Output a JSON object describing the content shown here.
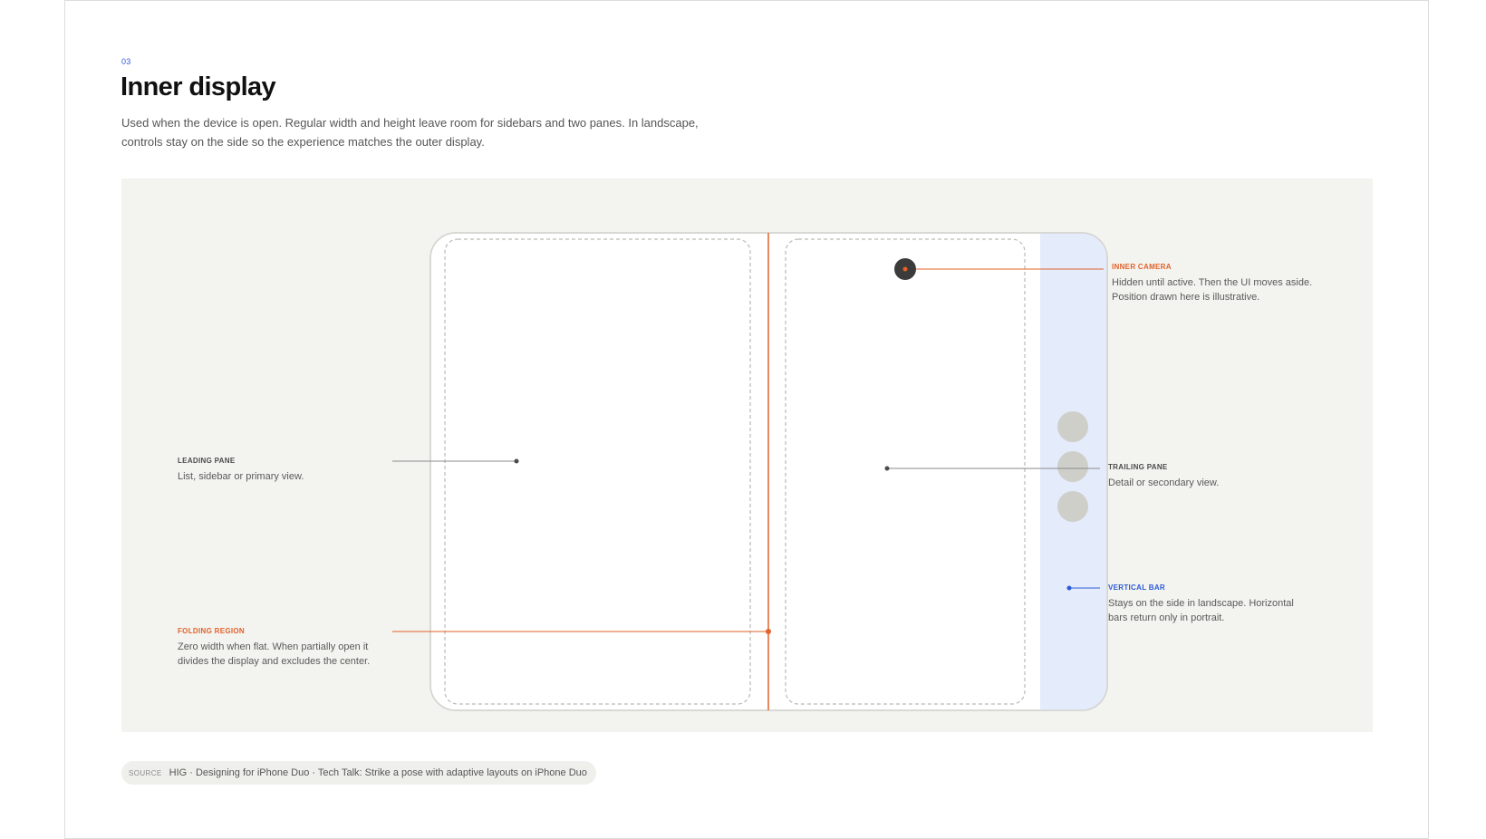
{
  "section": {
    "number": "03"
  },
  "title": "Inner display",
  "description": "Used when the device is open. Regular width and height leave room for sidebars and two panes. In landscape, controls stay on the side so the experience matches the outer display.",
  "annotations": {
    "leading_pane": {
      "title": "LEADING PANE",
      "body": "List, sidebar or primary view."
    },
    "folding_region": {
      "title": "FOLDING REGION",
      "body": "Zero width when flat. When partially open it divides the display and excludes the center."
    },
    "inner_camera": {
      "title": "INNER CAMERA",
      "body": "Hidden until active. Then the UI moves aside. Position drawn here is illustrative."
    },
    "trailing_pane": {
      "title": "TRAILING PANE",
      "body": "Detail or secondary view."
    },
    "vertical_bar": {
      "title": "VERTICAL BAR",
      "body": "Stays on the side in landscape. Horizontal bars return only in portrait."
    }
  },
  "source": {
    "tag": "SOURCE",
    "text": "HIG · Designing for iPhone Duo · Tech Talk: Strike a pose with adaptive layouts on iPhone Duo"
  },
  "colors": {
    "accent_orange": "#e2622a",
    "accent_blue": "#2b5bd7",
    "vertical_bar_fill": "#e4ebfb",
    "stage_bg": "#f3f3ef",
    "camera": "#3b3b3b",
    "control_button": "#cfcfca"
  },
  "icons": {
    "camera": "camera-dot-icon",
    "controls": "circle-button-icon"
  }
}
